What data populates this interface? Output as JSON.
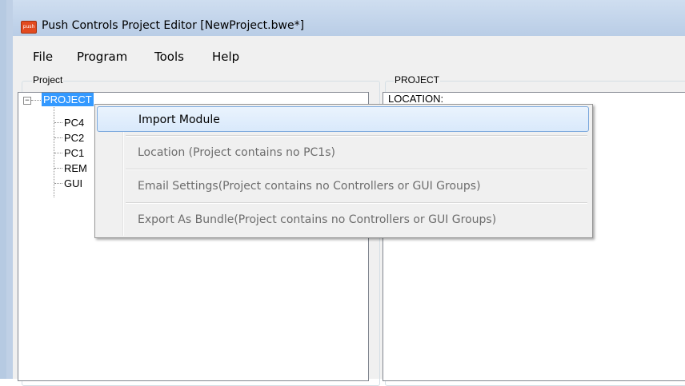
{
  "window": {
    "title": "Push Controls Project Editor [NewProject.bwe*]",
    "icon_label": "push"
  },
  "menubar": {
    "items": [
      {
        "label": "File"
      },
      {
        "label": "Program"
      },
      {
        "label": "Tools"
      },
      {
        "label": "Help"
      }
    ]
  },
  "left_panel": {
    "group_label": "Project",
    "tree": {
      "root": "PROJECT",
      "toggle": "−",
      "children": [
        "PC4",
        "PC2",
        "PC1",
        "REM",
        "GUI"
      ]
    }
  },
  "right_panel": {
    "group_label": "PROJECT",
    "content_text": "LOCATION:"
  },
  "context_menu": {
    "items": [
      {
        "label": "Import Module",
        "enabled": true,
        "highlighted": true
      },
      {
        "label": "Location (Project contains no PC1s)",
        "enabled": false
      },
      {
        "label": "Email Settings(Project contains no Controllers or GUI Groups)",
        "enabled": false
      },
      {
        "label": "Export As Bundle(Project contains no Controllers or GUI Groups)",
        "enabled": false
      }
    ]
  },
  "colors": {
    "selection": "#3399ff",
    "menu_highlight_border": "#7ca9dd",
    "titlebar": "#bfd0e6"
  }
}
